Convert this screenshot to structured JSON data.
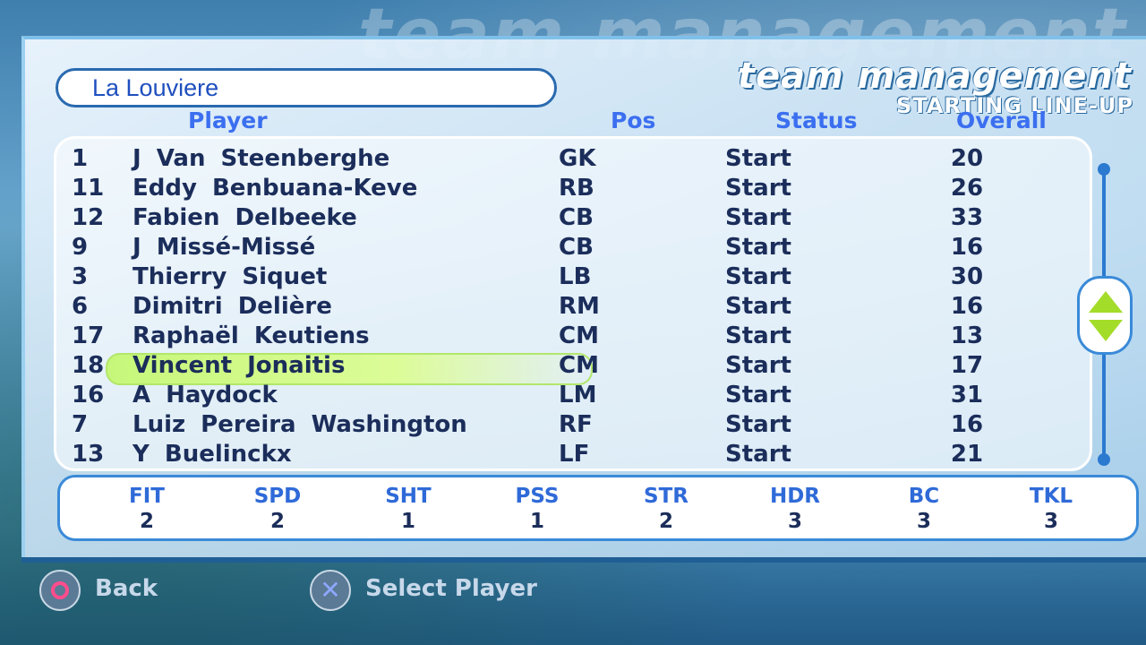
{
  "header": {
    "ghost_text": "team management",
    "title": "team management",
    "subtitle": "STARTING LINE-UP"
  },
  "team": {
    "name": "La Louviere"
  },
  "columns": {
    "player": "Player",
    "pos": "Pos",
    "status": "Status",
    "overall": "Overall"
  },
  "players": [
    {
      "num": "1",
      "name": "J Van Steenberghe",
      "pos": "GK",
      "status": "Start",
      "overall": "20"
    },
    {
      "num": "11",
      "name": "Eddy Benbuana-Keve",
      "pos": "RB",
      "status": "Start",
      "overall": "26"
    },
    {
      "num": "12",
      "name": "Fabien Delbeeke",
      "pos": "CB",
      "status": "Start",
      "overall": "33"
    },
    {
      "num": "9",
      "name": "J Missé-Missé",
      "pos": "CB",
      "status": "Start",
      "overall": "16"
    },
    {
      "num": "3",
      "name": "Thierry Siquet",
      "pos": "LB",
      "status": "Start",
      "overall": "30"
    },
    {
      "num": "6",
      "name": "Dimitri Delière",
      "pos": "RM",
      "status": "Start",
      "overall": "16"
    },
    {
      "num": "17",
      "name": "Raphaël Keutiens",
      "pos": "CM",
      "status": "Start",
      "overall": "13"
    },
    {
      "num": "18",
      "name": "Vincent Jonaitis",
      "pos": "CM",
      "status": "Start",
      "overall": "17"
    },
    {
      "num": "16",
      "name": "A Haydock",
      "pos": "LM",
      "status": "Start",
      "overall": "31"
    },
    {
      "num": "7",
      "name": "Luiz Pereira Washington",
      "pos": "RF",
      "status": "Start",
      "overall": "16"
    },
    {
      "num": "13",
      "name": "Y Buelinckx",
      "pos": "LF",
      "status": "Start",
      "overall": "21"
    }
  ],
  "selected_player_index": 7,
  "stats": [
    {
      "label": "FIT",
      "value": "2"
    },
    {
      "label": "SPD",
      "value": "2"
    },
    {
      "label": "SHT",
      "value": "1"
    },
    {
      "label": "PSS",
      "value": "1"
    },
    {
      "label": "STR",
      "value": "2"
    },
    {
      "label": "HDR",
      "value": "3"
    },
    {
      "label": "BC",
      "value": "3"
    },
    {
      "label": "TKL",
      "value": "3"
    }
  ],
  "hints": {
    "back": {
      "icon": "circle-button-icon",
      "label": "Back"
    },
    "select": {
      "icon": "cross-button-icon",
      "label": "Select Player"
    }
  },
  "colors": {
    "highlight": "#c6f77a",
    "column_header": "#3b6ff0",
    "text": "#1b2d5a",
    "accent": "#2b7ad0"
  }
}
